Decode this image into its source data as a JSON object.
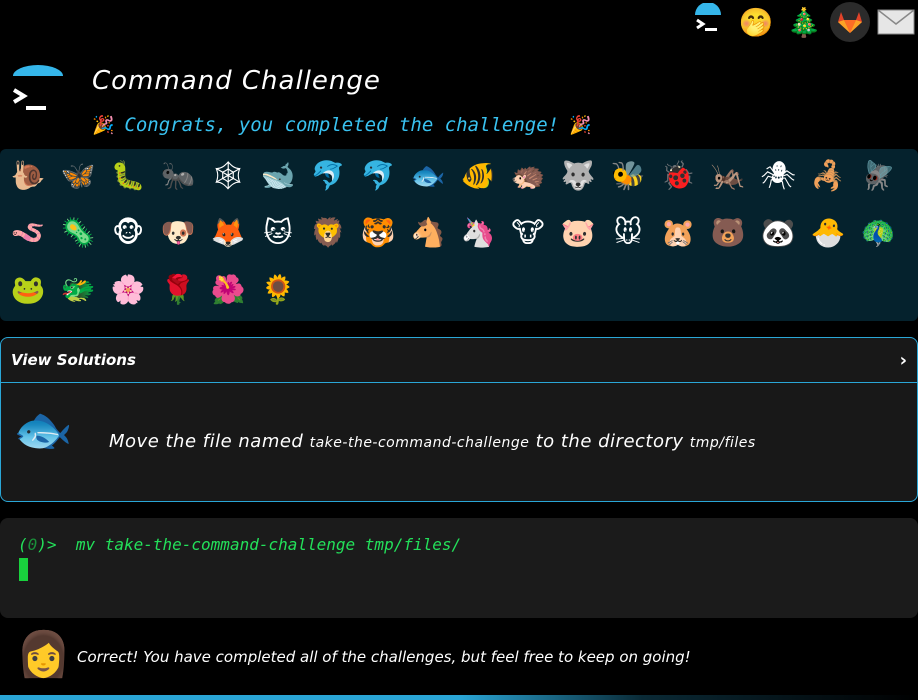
{
  "top_icons": [
    {
      "name": "terminal-icon",
      "glyph": ">_"
    },
    {
      "name": "hand-over-mouth-icon",
      "glyph": "🤭"
    },
    {
      "name": "christmas-tree-icon",
      "glyph": "🎄"
    },
    {
      "name": "gitlab-icon",
      "glyph": "🦊"
    },
    {
      "name": "envelope-icon",
      "glyph": "✉"
    }
  ],
  "header": {
    "title": "Command Challenge",
    "congrats": "Congrats, you completed the challenge!",
    "popper": "🎉"
  },
  "animals": {
    "row1": [
      "🐌",
      "🦋",
      "🐛",
      "🐜",
      "🕸",
      "🐋",
      "🐬",
      "🐬",
      "🐟",
      "🐠",
      "🦔",
      "🐺",
      "🐝",
      "🐞",
      "🦗",
      "🕷",
      "🦂",
      "🪰"
    ],
    "row2": [
      "🪱",
      "🦠",
      "🐵",
      "🐶",
      "🦊",
      "🐱",
      "🦁",
      "🐯",
      "🐴",
      "🦄",
      "🐮",
      "🐷",
      "🐭",
      "🐹",
      "🐻",
      "🐼",
      "🐣",
      "🦚"
    ],
    "row3": [
      "🐸",
      "🐲",
      "🌸",
      "🌹",
      "🌺",
      "🌻"
    ]
  },
  "solutions": {
    "header_label": "View Solutions",
    "chevron": "›",
    "fish_glyph": "🐟",
    "instruction_prefix": "Move the file named",
    "instruction_file": "take-the-command-challenge",
    "instruction_mid": "to the directory",
    "instruction_dir": "tmp/files"
  },
  "terminal": {
    "prompt_open": "(",
    "prompt_zero": "0",
    "prompt_close": ")>",
    "command": "mv take-the-command-challenge tmp/files/"
  },
  "footer": {
    "avatar_glyph": "👩",
    "message": "Correct! You have completed all of the challenges, but feel free to keep on going!"
  }
}
